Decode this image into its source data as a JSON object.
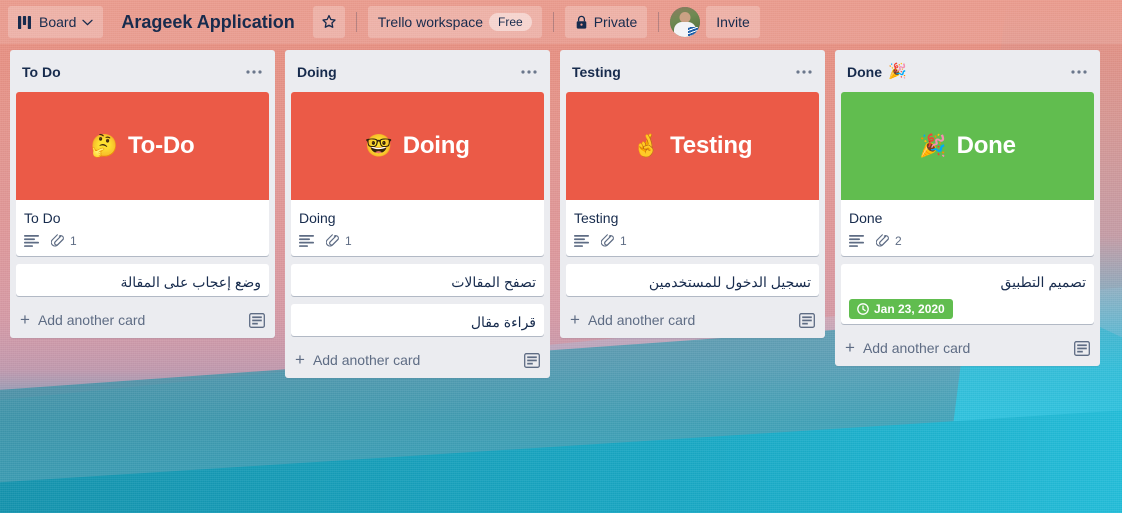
{
  "topbar": {
    "board_button": "Board",
    "board_title": "Arageek Application",
    "workspace": "Trello workspace",
    "plan_badge": "Free",
    "visibility": "Private",
    "invite": "Invite"
  },
  "theme": {
    "cover_red": "#eb5a47",
    "cover_green": "#61bd4f",
    "due_badge_green": "#61bd4f",
    "list_background": "#ebecf0",
    "text_dark": "#172b4d",
    "text_muted": "#5e6c84"
  },
  "lists": [
    {
      "title": "To Do",
      "title_emoji": "",
      "cover": {
        "emoji": "🤔",
        "text": "To-Do",
        "color": "#eb5a47"
      },
      "cards": [
        {
          "title": "To Do",
          "rtl": false,
          "has_cover": true,
          "description": true,
          "attachments": "1",
          "due": null
        },
        {
          "title": "وضع إعجاب على المقالة",
          "rtl": true,
          "has_cover": false,
          "description": false,
          "attachments": null,
          "due": null
        }
      ],
      "add_card": "Add another card"
    },
    {
      "title": "Doing",
      "title_emoji": "",
      "cover": {
        "emoji": "🤓",
        "text": "Doing",
        "color": "#eb5a47"
      },
      "cards": [
        {
          "title": "Doing",
          "rtl": false,
          "has_cover": true,
          "description": true,
          "attachments": "1",
          "due": null
        },
        {
          "title": "تصفح المقالات",
          "rtl": true,
          "has_cover": false,
          "description": false,
          "attachments": null,
          "due": null
        },
        {
          "title": "قراءة مقال",
          "rtl": true,
          "has_cover": false,
          "description": false,
          "attachments": null,
          "due": null
        }
      ],
      "add_card": "Add another card"
    },
    {
      "title": "Testing",
      "title_emoji": "",
      "cover": {
        "emoji": "🤞",
        "text": "Testing",
        "color": "#eb5a47"
      },
      "cards": [
        {
          "title": "Testing",
          "rtl": false,
          "has_cover": true,
          "description": true,
          "attachments": "1",
          "due": null
        },
        {
          "title": "تسجيل الدخول للمستخدمين",
          "rtl": true,
          "has_cover": false,
          "description": false,
          "attachments": null,
          "due": null
        }
      ],
      "add_card": "Add another card"
    },
    {
      "title": "Done",
      "title_emoji": "🎉",
      "cover": {
        "emoji": "🎉",
        "text": "Done",
        "color": "#61bd4f"
      },
      "cards": [
        {
          "title": "Done",
          "rtl": false,
          "has_cover": true,
          "description": true,
          "attachments": "2",
          "due": null
        },
        {
          "title": "تصميم التطبيق",
          "rtl": true,
          "has_cover": false,
          "description": false,
          "attachments": null,
          "due": "Jan 23, 2020"
        }
      ],
      "add_card": "Add another card"
    }
  ],
  "icons": {
    "board": "board-icon",
    "chevron": "chevron-down-icon",
    "star": "star-icon",
    "lock": "lock-icon",
    "description": "description-icon",
    "attachment": "attachment-icon",
    "clock": "clock-icon",
    "template": "card-template-icon",
    "plus": "plus-icon",
    "more": "more-options-icon"
  }
}
